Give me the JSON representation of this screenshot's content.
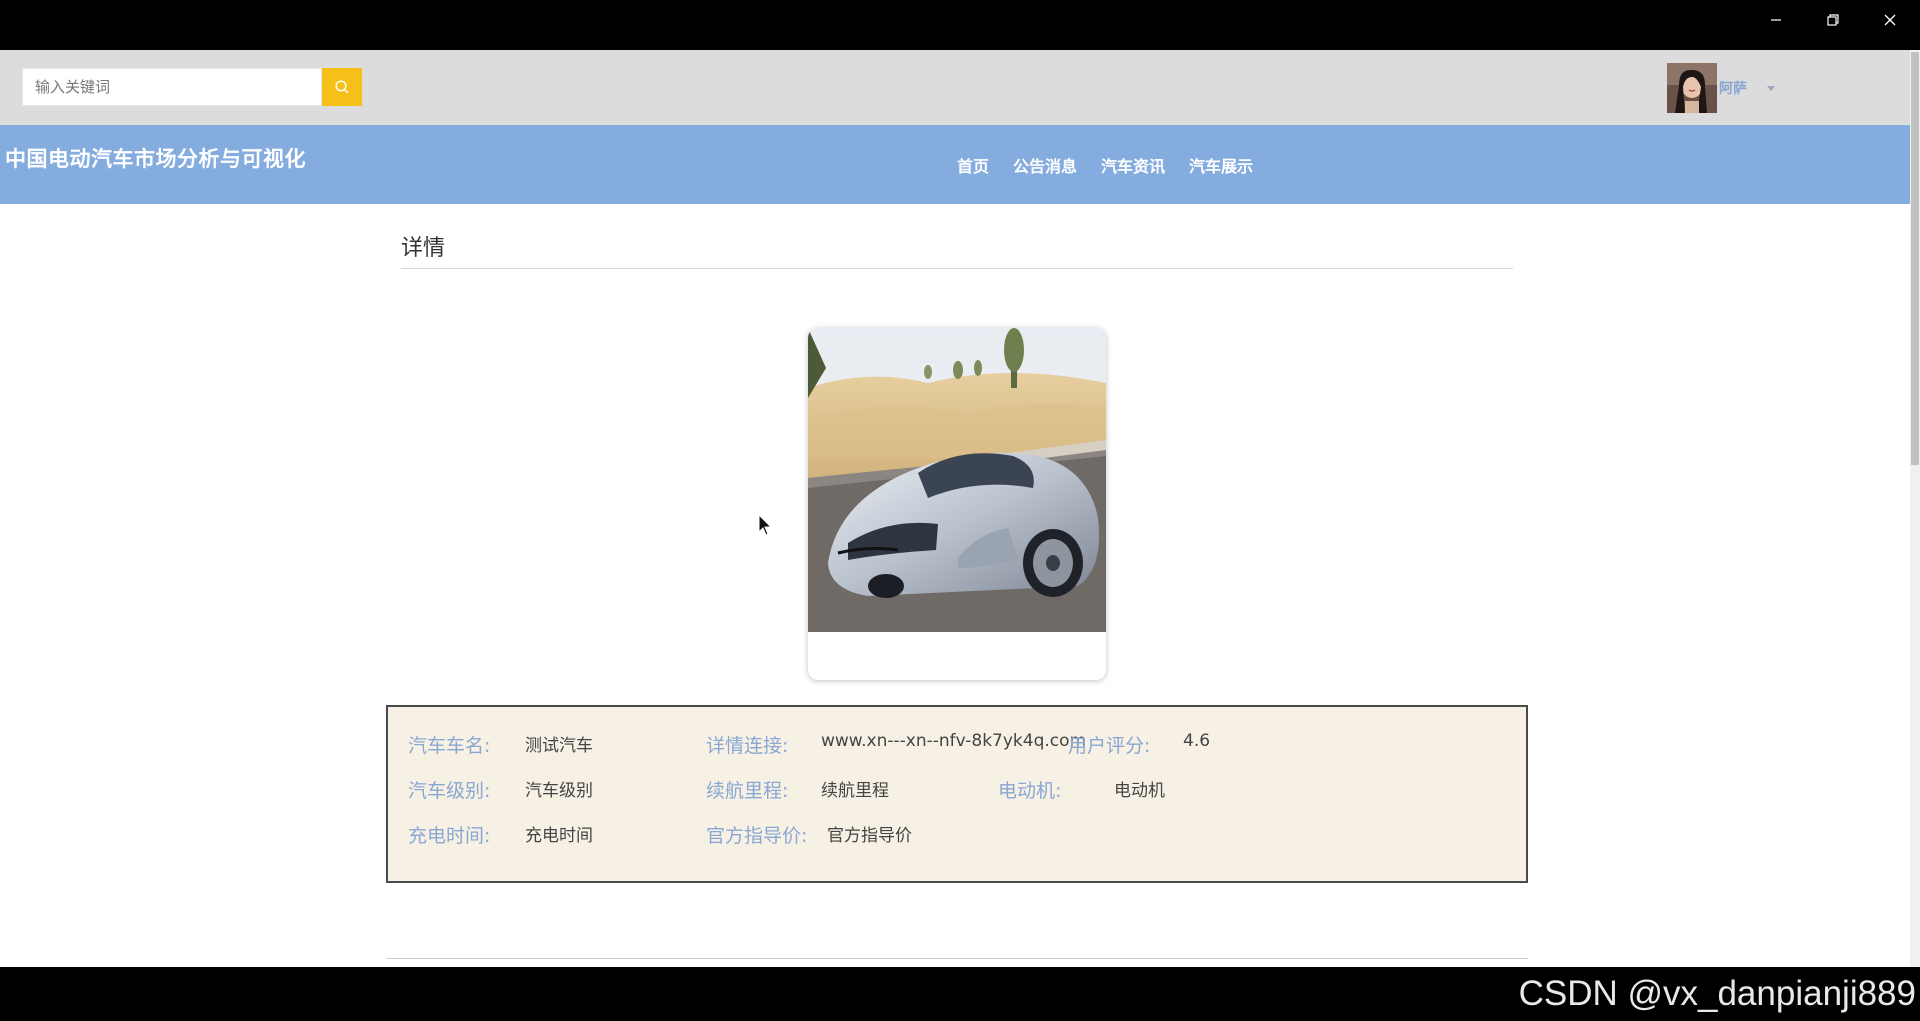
{
  "window": {
    "minimize_icon": "minimize-icon",
    "restore_icon": "restore-icon",
    "close_icon": "close-icon"
  },
  "search": {
    "placeholder": "输入关键词",
    "icon": "search-icon"
  },
  "user": {
    "name": "阿萨"
  },
  "site": {
    "title": "中国电动汽车市场分析与可视化"
  },
  "nav": {
    "items": [
      "首页",
      "公告消息",
      "汽车资讯",
      "汽车展示"
    ]
  },
  "detail": {
    "heading": "详情",
    "fields": {
      "car_name": {
        "label": "汽车车名:",
        "value": "测试汽车"
      },
      "detail_link": {
        "label": "详情连接:",
        "value": "www.xn---xn--nfv-8k7yk4q.com"
      },
      "user_rating": {
        "label": "用户评分:",
        "value": "4.6"
      },
      "car_level": {
        "label": "汽车级别:",
        "value": "汽车级别"
      },
      "range": {
        "label": "续航里程:",
        "value": "续航里程"
      },
      "motor": {
        "label": "电动机:",
        "value": "电动机"
      },
      "charge_time": {
        "label": "充电时间:",
        "value": "充电时间"
      },
      "msrp": {
        "label": "官方指导价:",
        "value": "官方指导价"
      }
    }
  },
  "watermark": "CSDN @vx_danpianji889",
  "colors": {
    "topbar": "#dcdcdc",
    "navbar": "#84acdf",
    "search_button": "#f5c017",
    "info_label": "#8aa7d4",
    "info_background": "#f6f1e4"
  }
}
